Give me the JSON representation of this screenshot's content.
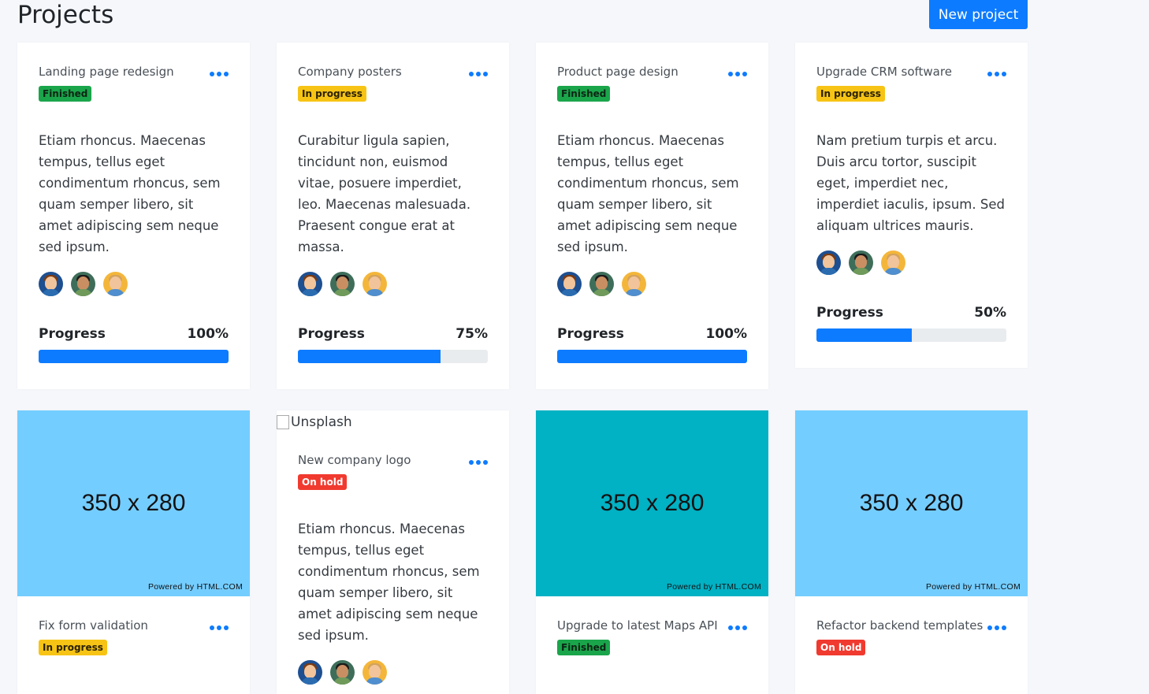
{
  "header": {
    "title": "Projects",
    "new_project_label": "New project"
  },
  "cards": [
    {
      "title": "Landing page redesign",
      "status": "Finished",
      "description": "Etiam rhoncus. Maecenas tempus, tellus eget condimentum rhoncus, sem quam semper libero, sit amet adipiscing sem neque sed ipsum.",
      "progress_label": "Progress",
      "progress_value": "100%",
      "progress_percent": 100
    },
    {
      "title": "Company posters",
      "status": "In progress",
      "description": "Curabitur ligula sapien, tincidunt non, euismod vitae, posuere imperdiet, leo. Maecenas malesuada. Praesent congue erat at massa.",
      "progress_label": "Progress",
      "progress_value": "75%",
      "progress_percent": 75
    },
    {
      "title": "Product page design",
      "status": "Finished",
      "description": "Etiam rhoncus. Maecenas tempus, tellus eget condimentum rhoncus, sem quam semper libero, sit amet adipiscing sem neque sed ipsum.",
      "progress_label": "Progress",
      "progress_value": "100%",
      "progress_percent": 100
    },
    {
      "title": "Upgrade CRM software",
      "status": "In progress",
      "description": "Nam pretium turpis et arcu. Duis arcu tortor, suscipit eget, imperdiet nec, imperdiet iaculis, ipsum. Sed aliquam ultrices mauris.",
      "progress_label": "Progress",
      "progress_value": "50%",
      "progress_percent": 50
    },
    {
      "image_text": "350 x 280",
      "image_credit": "Powered by HTML.COM",
      "image_color": "#74cdff",
      "title": "Fix form validation",
      "status": "In progress"
    },
    {
      "image_alt": "Unsplash",
      "title": "New company logo",
      "status": "On hold",
      "description": "Etiam rhoncus. Maecenas tempus, tellus eget condimentum rhoncus, sem quam semper libero, sit amet adipiscing sem neque sed ipsum."
    },
    {
      "image_text": "350 x 280",
      "image_credit": "Powered by HTML.COM",
      "image_color": "#01b1c4",
      "title": "Upgrade to latest Maps API",
      "status": "Finished"
    },
    {
      "image_text": "350 x 280",
      "image_credit": "Powered by HTML.COM",
      "image_color": "#74cdff",
      "title": "Refactor backend templates",
      "status": "On hold"
    }
  ],
  "colors": {
    "accent": "#0d7bff",
    "finished": "#1aa54b",
    "in_progress": "#f7c415",
    "on_hold": "#f13a2f"
  },
  "avatar_icons": [
    "avatar-woman-icon",
    "avatar-man-glasses-icon",
    "avatar-man-beard-icon"
  ]
}
